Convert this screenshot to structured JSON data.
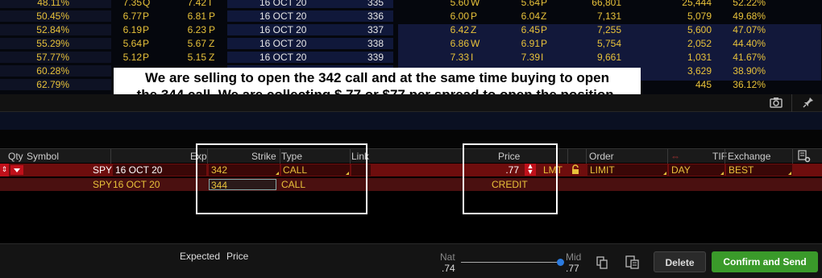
{
  "chain_rows": [
    {
      "pct": "48.11%",
      "bid": "7.35",
      "bx": "Q",
      "ask": "7.42",
      "ax": "I",
      "exp": "16 OCT 20",
      "strike": "335",
      "bid2": "5.60",
      "bx2": "W",
      "ask2": "5.64",
      "ax2": "P",
      "vol": "66,801",
      "oi": "25,444",
      "prob": "52.22%"
    },
    {
      "pct": "50.45%",
      "bid": "6.77",
      "bx": "P",
      "ask": "6.81",
      "ax": "P",
      "exp": "16 OCT 20",
      "strike": "336",
      "bid2": "6.00",
      "bx2": "P",
      "ask2": "6.04",
      "ax2": "Z",
      "vol": "7,131",
      "oi": "5,079",
      "prob": "49.68%"
    },
    {
      "pct": "52.84%",
      "bid": "6.19",
      "bx": "P",
      "ask": "6.23",
      "ax": "P",
      "exp": "16 OCT 20",
      "strike": "337",
      "bid2": "6.42",
      "bx2": "Z",
      "ask2": "6.45",
      "ax2": "P",
      "vol": "7,255",
      "oi": "5,600",
      "prob": "47.07%"
    },
    {
      "pct": "55.29%",
      "bid": "5.64",
      "bx": "P",
      "ask": "5.67",
      "ax": "Z",
      "exp": "16 OCT 20",
      "strike": "338",
      "bid2": "6.86",
      "bx2": "W",
      "ask2": "6.91",
      "ax2": "P",
      "vol": "5,754",
      "oi": "2,052",
      "prob": "44.40%"
    },
    {
      "pct": "57.77%",
      "bid": "5.12",
      "bx": "P",
      "ask": "5.15",
      "ax": "Z",
      "exp": "16 OCT 20",
      "strike": "339",
      "bid2": "7.33",
      "bx2": "I",
      "ask2": "7.39",
      "ax2": "I",
      "vol": "9,661",
      "oi": "1,031",
      "prob": "41.67%"
    },
    {
      "pct": "60.28%",
      "bid": "",
      "bx": "",
      "ask": "",
      "ax": "",
      "exp": "",
      "strike": "",
      "bid2": "",
      "bx2": "",
      "ask2": "",
      "ax2": "",
      "vol": "",
      "oi": "3,629",
      "prob": "38.90%"
    },
    {
      "pct": "62.79%",
      "bid": "",
      "bx": "",
      "ask": "",
      "ax": "",
      "exp": "",
      "strike": "",
      "bid2": "",
      "bx2": "",
      "ask2": "",
      "ax2": "",
      "vol": "",
      "oi": "445",
      "prob": "36.12%"
    }
  ],
  "callout": {
    "line1": "We are selling to open the 342 call and at the same time buying to open",
    "line2": "the 344 call. We are collecting $.77 or $77 per spread to open the position."
  },
  "toolbar": {
    "camera_icon": "camera-icon",
    "pin_icon": "pin-icon"
  },
  "order_header": {
    "qty": "Qty",
    "symbol": "Symbol",
    "exp": "Exp",
    "strike": "Strike",
    "type": "Type",
    "link": "Link",
    "price": "Price",
    "order": "Order",
    "tif": "TIF",
    "exchange": "Exchange"
  },
  "order_rows": [
    {
      "symbol": "SPY",
      "exp": "16 OCT 20",
      "strike": "342",
      "type": "CALL",
      "price": ".77",
      "price_type": "LMT",
      "order": "LIMIT",
      "tif": "DAY",
      "exchange": "BEST"
    },
    {
      "symbol": "SPY",
      "exp": "16 OCT 20",
      "strike": "344",
      "type": "CALL",
      "price": "CREDIT"
    }
  ],
  "footer": {
    "expected_label": "Expected",
    "price_label": "Price",
    "nat_label": "Nat",
    "nat_value": ".74",
    "mid_label": "Mid",
    "mid_value": ".77",
    "delete_label": "Delete",
    "confirm_label": "Confirm and Send"
  },
  "colors": {
    "accent_green": "#3a9a2a",
    "row_red": "#6e0d0d",
    "text_yellow": "#e8c23a"
  }
}
